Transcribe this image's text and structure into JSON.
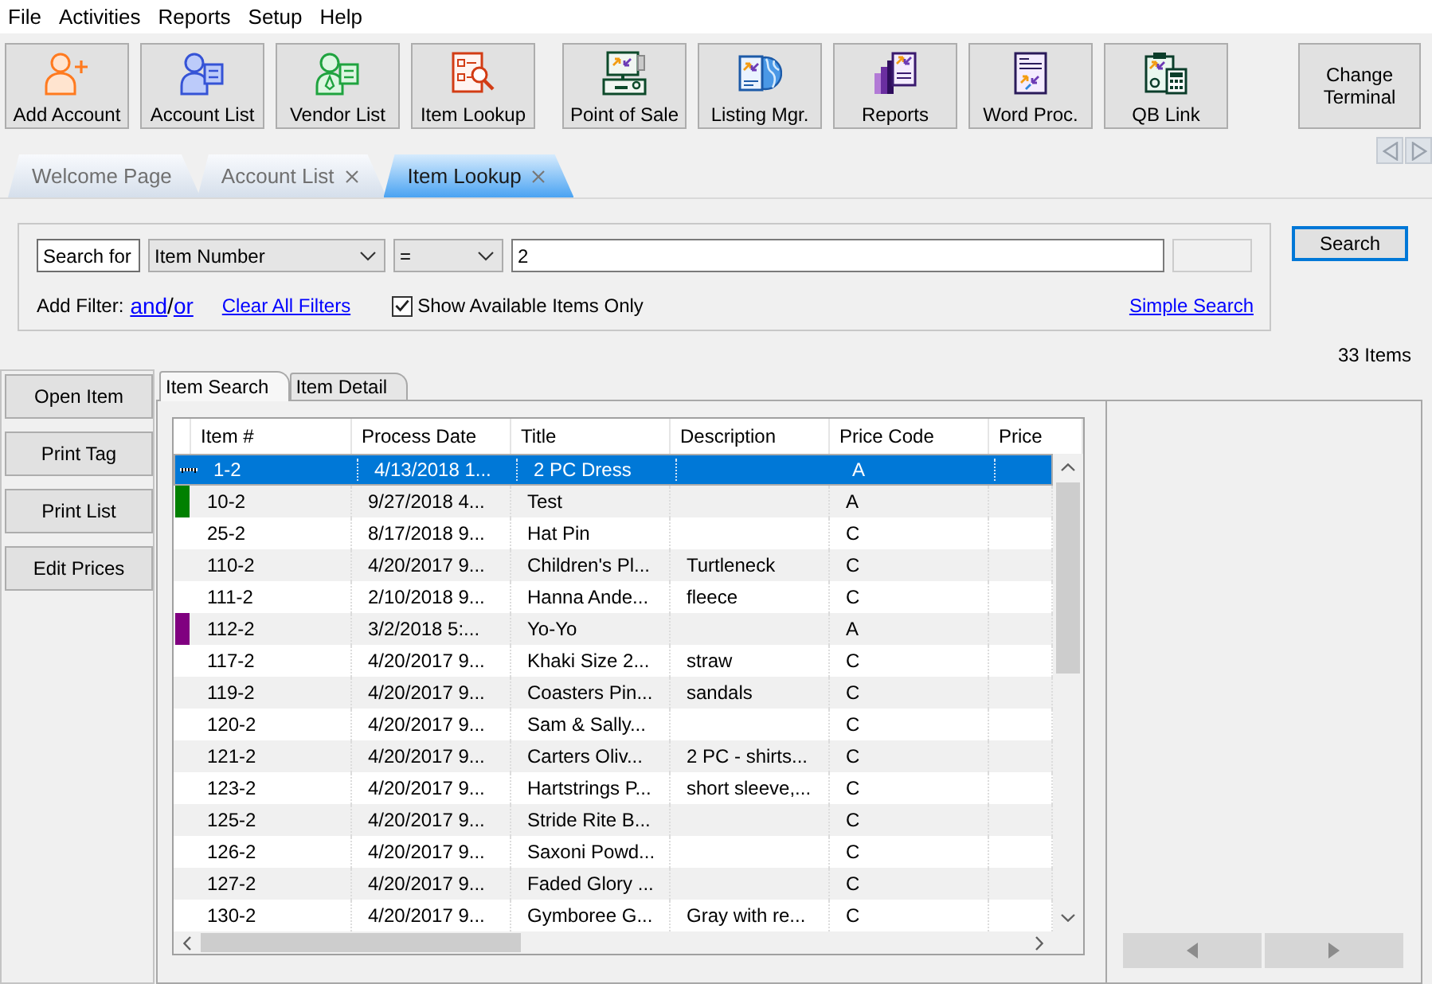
{
  "menu": [
    "File",
    "Activities",
    "Reports",
    "Setup",
    "Help"
  ],
  "toolbar": {
    "groups": [
      [
        "Add Account",
        "Account List",
        "Vendor List",
        "Item Lookup"
      ],
      [
        "Point of Sale",
        "Listing Mgr.",
        "Reports",
        "Word Proc.",
        "QB Link"
      ]
    ],
    "change_terminal": "Change Terminal"
  },
  "document_tabs": [
    {
      "label": "Welcome Page",
      "selected": false,
      "closable": false
    },
    {
      "label": "Account List",
      "selected": false,
      "closable": true
    },
    {
      "label": "Item Lookup",
      "selected": true,
      "closable": true
    }
  ],
  "search": {
    "label": "Search for",
    "field": "Item Number",
    "operator": "=",
    "value": "2",
    "button": "Search",
    "add_filter_label": "Add Filter:",
    "and_link": "and",
    "separator": "/",
    "or_link": "or",
    "clear_link": "Clear All Filters",
    "available_only": {
      "label": "Show Available Items Only",
      "checked": true
    },
    "simple_search_link": "Simple Search"
  },
  "item_count": "33 Items",
  "side_buttons": [
    "Open Item",
    "Print Tag",
    "Print List",
    "Edit Prices"
  ],
  "sub_tabs": [
    {
      "label": "Item Search",
      "selected": true
    },
    {
      "label": "Item Detail",
      "selected": false
    }
  ],
  "table": {
    "columns": [
      "Item #",
      "Process Date",
      "Title",
      "Description",
      "Price Code",
      "Price"
    ],
    "rows": [
      {
        "item_no": "1-2",
        "process_date": "4/13/2018 1...",
        "title": "2 PC Dress",
        "price_code": "A",
        "selected": true
      },
      {
        "item_no": "10-2",
        "process_date": "9/27/2018 4...",
        "title": "Test",
        "price_code": "A",
        "selected": false,
        "color": "#008000"
      },
      {
        "item_no": "25-2",
        "process_date": "8/17/2018 9...",
        "title": "Hat Pin",
        "price_code": "C",
        "selected": false
      },
      {
        "item_no": "110-2",
        "process_date": "4/20/2017 9...",
        "title": "Children's Pl...",
        "description": "Turtleneck",
        "price_code": "C",
        "selected": false
      },
      {
        "item_no": "111-2",
        "process_date": "2/10/2018 9...",
        "title": "Hanna Ande...",
        "description": "fleece",
        "price_code": "C",
        "selected": false
      },
      {
        "item_no": "112-2",
        "process_date": "3/2/2018 5:...",
        "title": "Yo-Yo",
        "price_code": "A",
        "selected": false,
        "color": "#800080"
      },
      {
        "item_no": "117-2",
        "process_date": "4/20/2017 9...",
        "title": "Khaki Size 2...",
        "description": "straw",
        "price_code": "C",
        "selected": false
      },
      {
        "item_no": "119-2",
        "process_date": "4/20/2017 9...",
        "title": "Coasters Pin...",
        "description": "sandals",
        "price_code": "C",
        "selected": false
      },
      {
        "item_no": "120-2",
        "process_date": "4/20/2017 9...",
        "title": "Sam & Sally...",
        "price_code": "C",
        "selected": false
      },
      {
        "item_no": "121-2",
        "process_date": "4/20/2017 9...",
        "title": "Carters Oliv...",
        "description": "2 PC - shirts...",
        "price_code": "C",
        "selected": false
      },
      {
        "item_no": "123-2",
        "process_date": "4/20/2017 9...",
        "title": "Hartstrings P...",
        "description": "short sleeve,...",
        "price_code": "C",
        "selected": false
      },
      {
        "item_no": "125-2",
        "process_date": "4/20/2017 9...",
        "title": "Stride Rite B...",
        "price_code": "C",
        "selected": false
      },
      {
        "item_no": "126-2",
        "process_date": "4/20/2017 9...",
        "title": "Saxoni Powd...",
        "price_code": "C",
        "selected": false
      },
      {
        "item_no": "127-2",
        "process_date": "4/20/2017 9...",
        "title": "Faded Glory ...",
        "price_code": "C",
        "selected": false
      },
      {
        "item_no": "130-2",
        "process_date": "4/20/2017 9...",
        "title": "Gymboree G...",
        "description": "Gray with re...",
        "price_code": "C",
        "selected": false
      }
    ]
  }
}
